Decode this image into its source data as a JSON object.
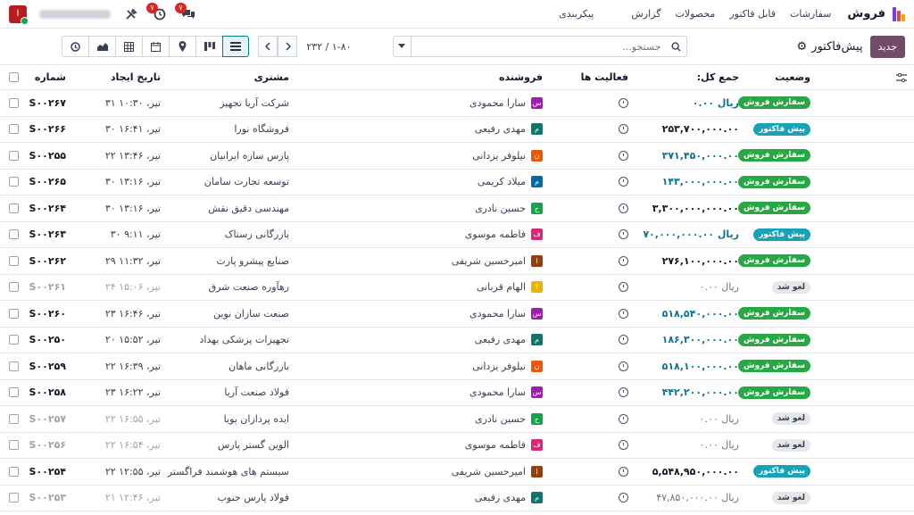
{
  "app": {
    "name": "فروش",
    "menu": [
      "سفارشات",
      "قابل فاکتور",
      "محصولات",
      "گزارش",
      "پیکربندی"
    ],
    "chat_badge": "۷",
    "activity_badge": "۷",
    "brand_colors": [
      "#f59e0b",
      "#ef4444",
      "#7c3aed"
    ]
  },
  "control": {
    "new_label": "جدید",
    "view_title": "پیش‌فاکتور",
    "search_placeholder": "جستجو...",
    "pager": "۱-۸۰ / ۲۳۲"
  },
  "table": {
    "headers": {
      "status": "وضعیت",
      "total": "جمع کل:",
      "activities": "فعالیت ها",
      "salesperson": "فروشنده",
      "customer": "مشتری",
      "date": "تاریخ ایجاد",
      "number": "شماره"
    },
    "rows": [
      {
        "status": "سفارش فروش",
        "stype": "sale",
        "total": "ریال ۰.۰۰",
        "ttype": "teal",
        "sp": "سارا محمودی",
        "init": "س",
        "color": "#a21caf",
        "customer": "شرکت آریا تجهیز",
        "date": "تیر، ۱۰:۳۰ ۳۱",
        "num": "S۰۰۲۶۷",
        "cancel": false
      },
      {
        "status": "پیش فاکتور",
        "stype": "quote",
        "total": "۲۵۳,۷۰۰,۰۰۰.۰۰",
        "ttype": "dark",
        "sp": "مهدی رفیعی",
        "init": "م",
        "color": "#0f766e",
        "customer": "فروشگاه نورا",
        "date": "تیر، ۱۶:۴۱ ۳۰",
        "num": "S۰۰۲۶۶",
        "cancel": false
      },
      {
        "status": "سفارش فروش",
        "stype": "sale",
        "total": "۳۷۱,۴۵۰,۰۰۰.۰۰",
        "ttype": "teal",
        "sp": "نیلوفر یزدانی",
        "init": "ن",
        "color": "#ea580c",
        "customer": "پارس سازه ایرانیان",
        "date": "تیر، ۱۳:۴۶ ۲۲",
        "num": "S۰۰۲۵۵",
        "cancel": false
      },
      {
        "status": "سفارش فروش",
        "stype": "sale",
        "total": "۱۴۳,۰۰۰,۰۰۰.۰۰",
        "ttype": "teal",
        "sp": "میلاد کریمی",
        "init": "م",
        "color": "#0369a1",
        "customer": "توسعه تجارت سامان",
        "date": "تیر، ۱۳:۱۶ ۳۰",
        "num": "S۰۰۲۶۵",
        "cancel": false
      },
      {
        "status": "سفارش فروش",
        "stype": "sale",
        "total": "۳,۳۰۰,۰۰۰,۰۰۰.۰۰",
        "ttype": "dark",
        "sp": "حسین نادری",
        "init": "ح",
        "color": "#16a34a",
        "customer": "مهندسی دقیق نقش",
        "date": "تیر، ۱۳:۱۶ ۳۰",
        "num": "S۰۰۲۶۴",
        "cancel": false
      },
      {
        "status": "پیش فاکتور",
        "stype": "quote",
        "total": "ریال ۷۰,۰۰۰,۰۰۰.۰۰",
        "ttype": "teal",
        "sp": "فاطمه موسوی",
        "init": "ف",
        "color": "#db2777",
        "customer": "بازرگانی رستاک",
        "date": "تیر، ۹:۱۱ ۳۰",
        "num": "S۰۰۲۶۳",
        "cancel": false
      },
      {
        "status": "سفارش فروش",
        "stype": "sale",
        "total": "۲۷۶,۱۰۰,۰۰۰.۰۰",
        "ttype": "dark",
        "sp": "امیرحسین شریفی",
        "init": "ا",
        "color": "#92400e",
        "customer": "صنایع پیشرو پارت",
        "date": "تیر، ۱۱:۳۲ ۲۹",
        "num": "S۰۰۲۶۲",
        "cancel": false
      },
      {
        "status": "لغو شد",
        "stype": "cancel",
        "total": "ریال ۰.۰۰",
        "ttype": "muted",
        "sp": "الهام قربانی",
        "init": "ا",
        "color": "#eab308",
        "customer": "رهآوره صنعت شرق",
        "date": "تیر، ۱۵:۰۶ ۲۴",
        "num": "S۰۰۲۶۱",
        "cancel": true
      },
      {
        "status": "سفارش فروش",
        "stype": "sale",
        "total": "۵۱۸,۵۴۰,۰۰۰.۰۰",
        "ttype": "teal",
        "sp": "سارا محمودی",
        "init": "س",
        "color": "#a21caf",
        "customer": "صنعت سازان نوین",
        "date": "تیر، ۱۶:۴۶ ۲۳",
        "num": "S۰۰۲۶۰",
        "cancel": false
      },
      {
        "status": "سفارش فروش",
        "stype": "sale",
        "total": "۱۸۶,۳۰۰,۰۰۰.۰۰",
        "ttype": "teal",
        "sp": "مهدی رفیعی",
        "init": "م",
        "color": "#0f766e",
        "customer": "تجهیزات پزشکی بهداد",
        "date": "تیر، ۱۵:۵۲ ۲۰",
        "num": "S۰۰۲۵۰",
        "cancel": false
      },
      {
        "status": "سفارش فروش",
        "stype": "sale",
        "total": "۵۱۸,۱۰۰,۰۰۰.۰۰",
        "ttype": "teal",
        "sp": "نیلوفر یزدانی",
        "init": "ن",
        "color": "#ea580c",
        "customer": "بازرگانی ماهان",
        "date": "تیر، ۱۶:۳۹ ۲۲",
        "num": "S۰۰۲۵۹",
        "cancel": false
      },
      {
        "status": "سفارش فروش",
        "stype": "sale",
        "total": "۴۴۲,۲۰۰,۰۰۰.۰۰",
        "ttype": "teal",
        "sp": "سارا محمودی",
        "init": "س",
        "color": "#a21caf",
        "customer": "فولاد صنعت آریا",
        "date": "تیر، ۱۶:۲۲ ۲۳",
        "num": "S۰۰۲۵۸",
        "cancel": false
      },
      {
        "status": "لغو شد",
        "stype": "cancel",
        "total": "ریال ۰.۰۰",
        "ttype": "muted",
        "sp": "حسین نادری",
        "init": "ح",
        "color": "#16a34a",
        "customer": "ایده پردازان پویا",
        "date": "تیر، ۱۶:۵۵ ۲۲",
        "num": "S۰۰۲۵۷",
        "cancel": true
      },
      {
        "status": "لغو شد",
        "stype": "cancel",
        "total": "ریال ۰.۰۰",
        "ttype": "muted",
        "sp": "فاطمه موسوی",
        "init": "ف",
        "color": "#db2777",
        "customer": "الوین گستر پارس",
        "date": "تیر، ۱۶:۵۴ ۲۲",
        "num": "S۰۰۲۵۶",
        "cancel": true
      },
      {
        "status": "پیش فاکتور",
        "stype": "quote",
        "total": "۵,۵۴۸,۹۵۰,۰۰۰.۰۰",
        "ttype": "dark",
        "sp": "امیرحسین شریفی",
        "init": "ا",
        "color": "#92400e",
        "customer": "سیستم های هوشمند فراگستر",
        "date": "تیر، ۱۲:۵۵ ۲۲",
        "num": "S۰۰۲۵۴",
        "cancel": false
      },
      {
        "status": "لغو شد",
        "stype": "cancel",
        "total": "ریال ۴۷,۸۵۰,۰۰۰.۰۰",
        "ttype": "muted",
        "sp": "مهدی رفیعی",
        "init": "م",
        "color": "#0f766e",
        "customer": "فولاد پارس جنوب",
        "date": "تیر، ۱۲:۴۶ ۲۱",
        "num": "S۰۰۲۵۳",
        "cancel": true
      }
    ]
  }
}
